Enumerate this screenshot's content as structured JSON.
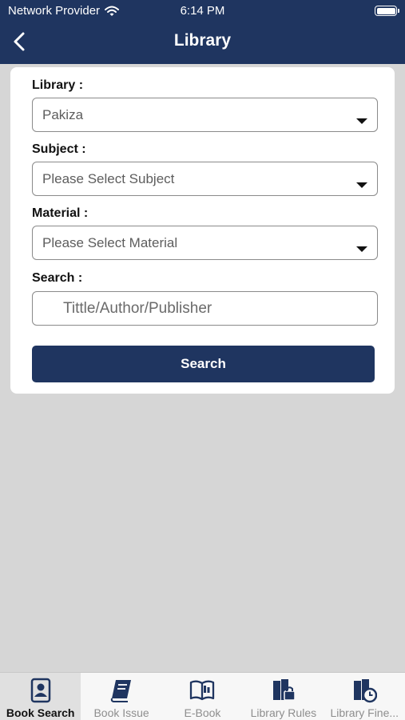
{
  "status_bar": {
    "carrier": "Network Provider",
    "time": "6:14 PM"
  },
  "header": {
    "title": "Library"
  },
  "form": {
    "library": {
      "label": "Library :",
      "value": "Pakiza"
    },
    "subject": {
      "label": "Subject :",
      "value": "Please Select Subject"
    },
    "material": {
      "label": "Material :",
      "value": "Please Select Material"
    },
    "search": {
      "label": "Search :",
      "placeholder": "Tittle/Author/Publisher"
    },
    "button_label": "Search"
  },
  "tabbar": {
    "items": [
      {
        "label": "Book Search",
        "icon": "book-search-icon",
        "active": true
      },
      {
        "label": "Book Issue",
        "icon": "book-issue-icon",
        "active": false
      },
      {
        "label": "E-Book",
        "icon": "e-book-icon",
        "active": false
      },
      {
        "label": "Library Rules",
        "icon": "library-rules-icon",
        "active": false
      },
      {
        "label": "Library Fine...",
        "icon": "library-fine-icon",
        "active": false
      }
    ]
  },
  "colors": {
    "primary": "#1f3560",
    "background": "#d6d6d6",
    "tab_inactive": "#8e8e8e"
  }
}
